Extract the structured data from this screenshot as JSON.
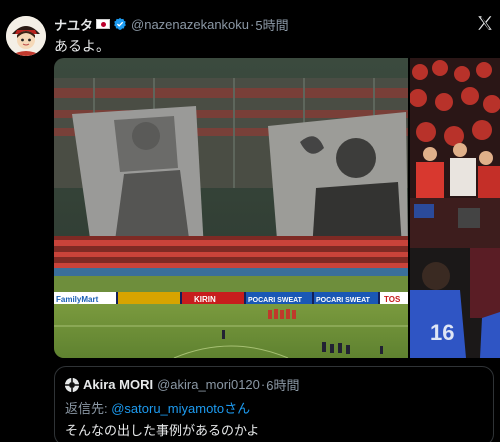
{
  "post": {
    "author_name": "ナユタ",
    "handle": "@nazenazekankoku",
    "separator": "·",
    "time": "5時間",
    "text": "あるよ。"
  },
  "media": {
    "board_ads": [
      "FamilyMart",
      "KIRIN",
      "POCARI SWEAT",
      "POCARI SWEAT",
      "TOS"
    ],
    "jersey_number": "16"
  },
  "quote": {
    "author_name": "Akira MORI",
    "handle": "@akira_mori0120",
    "separator": "·",
    "time": "6時間",
    "reply_prefix": "返信先: ",
    "reply_user": "@satoru_miyamoto",
    "reply_suffix": "さん",
    "text": "そんなの出した事例があるのかよ"
  },
  "colors": {
    "link": "#1d9bf0",
    "verified": "#1d9bf0",
    "muted": "#8b98a5"
  }
}
